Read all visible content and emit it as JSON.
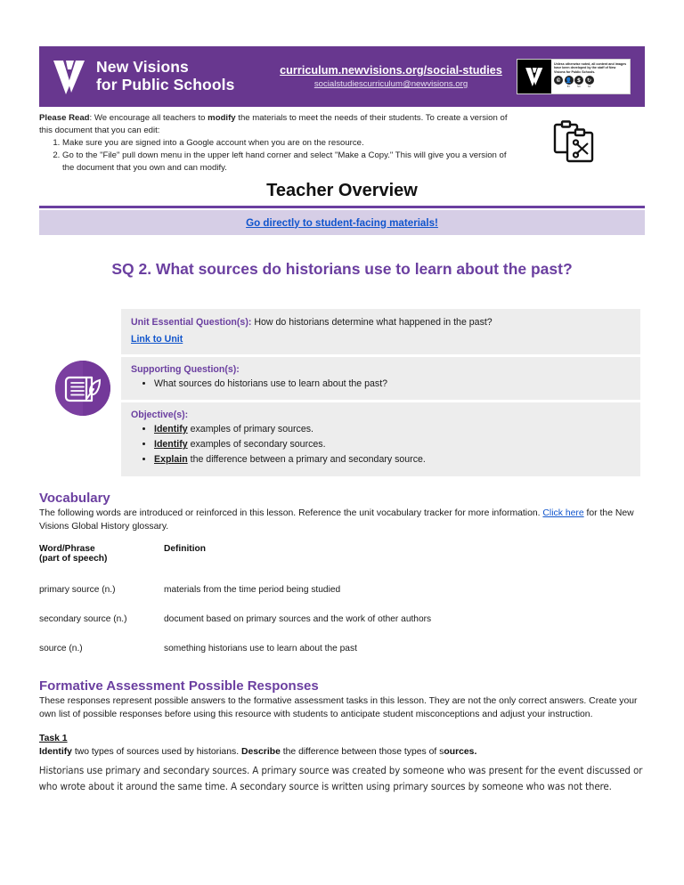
{
  "header": {
    "org_line1": "New Visions",
    "org_line2": "for Public Schools",
    "url": "curriculum.newvisions.org/social-studies",
    "email": "socialstudiescurriculum@newvisions.org",
    "license_text": "Unless otherwise noted, all content and images have been developed by the staff of New Visions for Public Schools.",
    "license_marks": [
      "cc",
      "by",
      "nc",
      "sa"
    ],
    "license_caps": [
      "",
      "BY",
      "NC",
      "SA"
    ],
    "brand_purple": "#68378F"
  },
  "please_read": {
    "label": "Please Read",
    "intro": ": We encourage all teachers to ",
    "bold_word": "modify",
    "intro_tail": " the materials to meet the needs of their students. To create a version of this document that you can edit:",
    "steps": [
      "Make sure you are signed into a Google account when you are on the resource.",
      "Go to the \"File\" pull down menu in the upper left hand corner and select \"Make a Copy.\" This will give you a version of the document that you own and can modify."
    ]
  },
  "title": "Teacher Overview",
  "student_link": "Go directly to student-facing materials!",
  "sq_heading": "SQ 2. What sources do historians use to learn about the past?",
  "info_boxes": {
    "unit_label": "Unit Essential Question(s):",
    "unit_question": " How do historians determine what happened in the past?",
    "unit_link": "Link to Unit",
    "supporting_label": "Supporting Question(s):",
    "supporting_items": [
      "What sources do historians use to learn about the past?"
    ],
    "objective_label": "Objective(s):",
    "objectives": [
      {
        "verb": "Identify",
        "rest": " examples of primary sources."
      },
      {
        "verb": "Identify",
        "rest": " examples of secondary sources."
      },
      {
        "verb": "Explain",
        "rest": " the difference between a primary and secondary source."
      }
    ]
  },
  "vocabulary": {
    "heading": "Vocabulary",
    "intro_a": "The following words are introduced or reinforced in this lesson. Reference the unit vocabulary tracker for more information. ",
    "link": "Click here",
    "intro_b": " for the New Visions Global History glossary.",
    "columns": [
      "Word/Phrase (part of speech)",
      "Definition"
    ],
    "col1_line1": "Word/Phrase",
    "col1_line2": "(part of speech)",
    "col2": "Definition",
    "rows": [
      {
        "term": "primary source (n.)",
        "definition": "materials from the time period being studied"
      },
      {
        "term": "secondary source (n.)",
        "definition": "document based on primary sources and the work of other authors"
      },
      {
        "term": "source (n.)",
        "definition": "something historians use to learn about the past"
      }
    ]
  },
  "formative": {
    "heading": "Formative Assessment Possible Responses",
    "intro": "These responses represent possible answers to the formative assessment tasks in this lesson. They are not the only correct answers. Create your own list of possible responses before using this resource with students to anticipate student misconceptions and adjust your instruction.",
    "task_label": "Task 1",
    "task_prompt_bold1": "Identify",
    "task_prompt_mid1": " two types of sources used by historians. ",
    "task_prompt_bold2": "Describe",
    "task_prompt_mid2": " the difference between those types of s",
    "task_prompt_bold3": "ources.",
    "task_answer": "Historians use primary and secondary sources. A primary source was created by someone who was present for the event discussed or who wrote about it around the same time. A secondary source is written using primary sources by someone who was not there."
  },
  "colors": {
    "purple": "#6B3FA0",
    "lavender": "#D6CEE6",
    "gray_box": "#EDEDED",
    "link_blue": "#1155CC"
  }
}
